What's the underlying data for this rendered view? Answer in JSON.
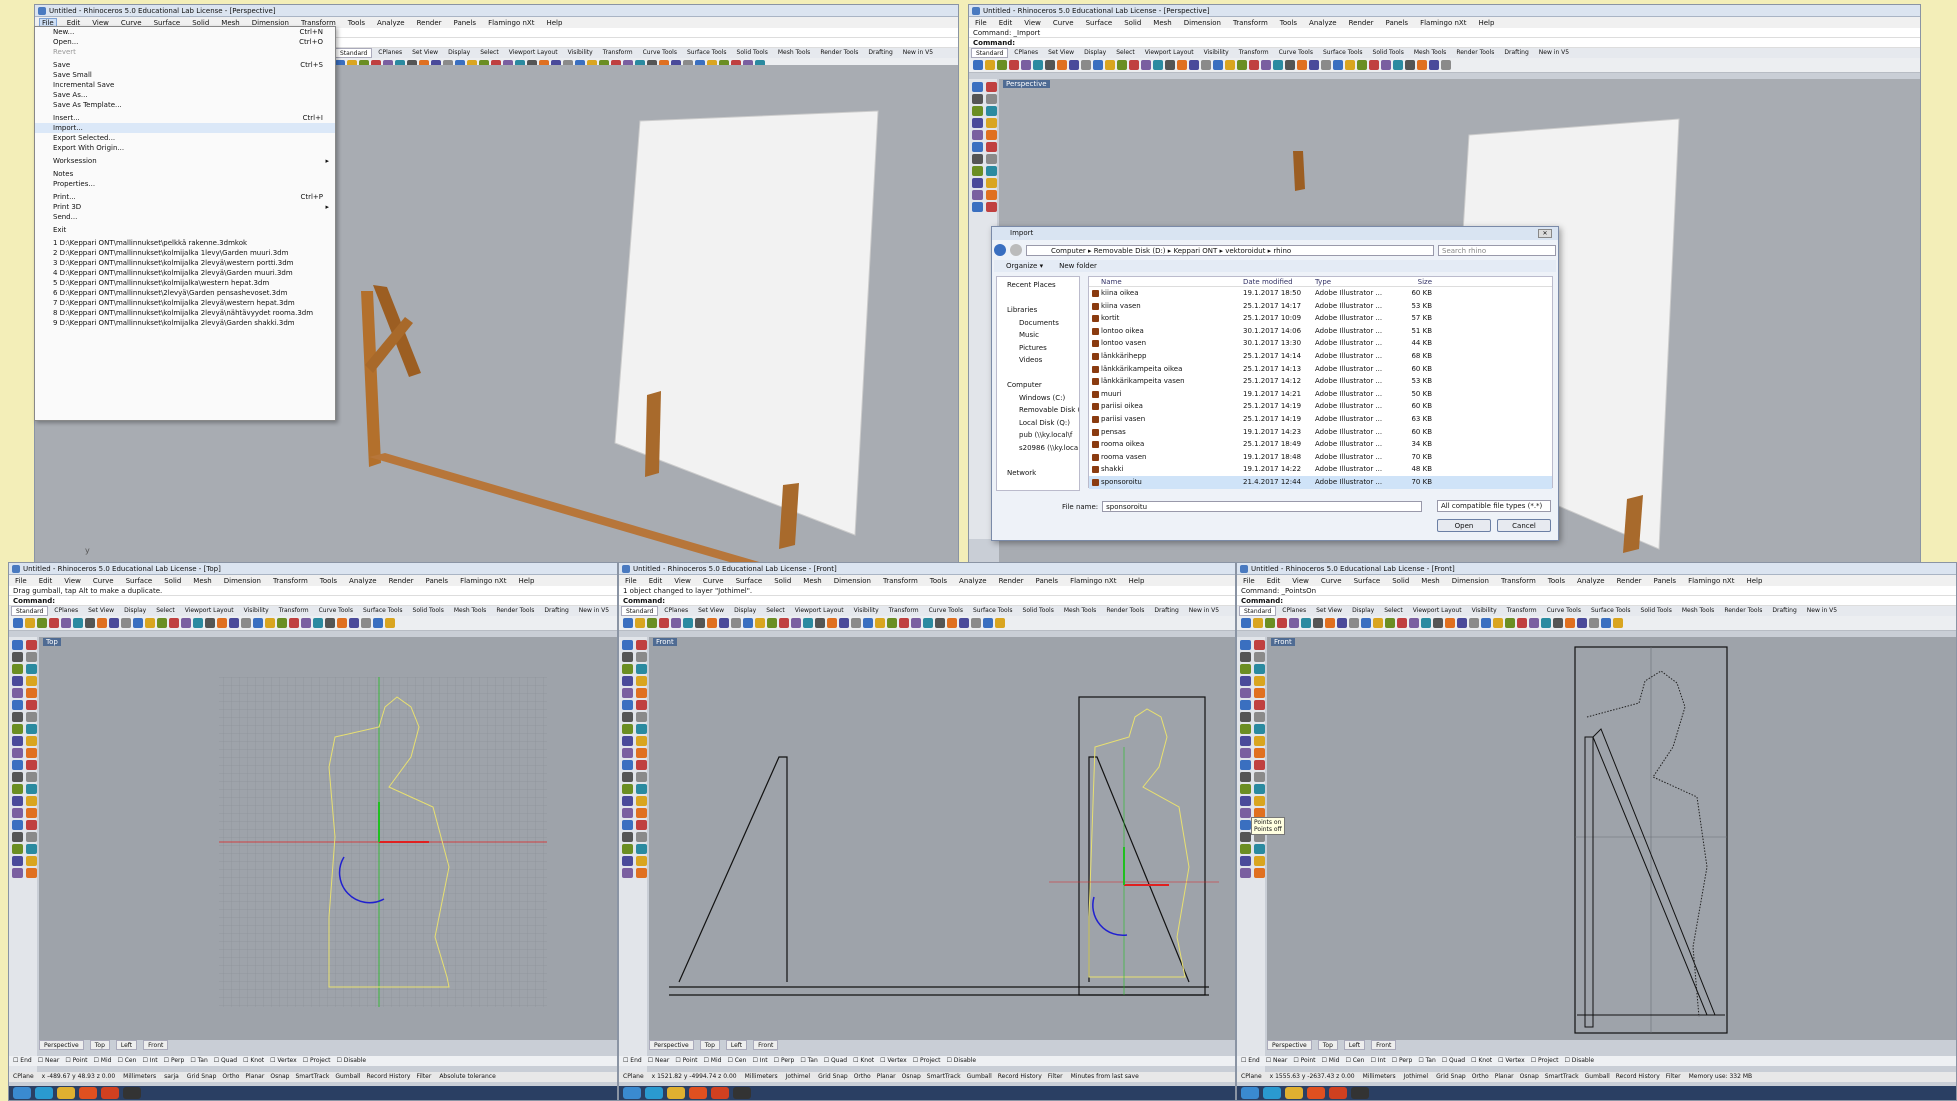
{
  "colors": {
    "accent": "#4a7ac0",
    "curve_yellow": "#e8e070",
    "axis_red": "#e02020",
    "axis_green": "#20c020"
  },
  "menus": [
    "File",
    "Edit",
    "View",
    "Curve",
    "Surface",
    "Solid",
    "Mesh",
    "Dimension",
    "Transform",
    "Tools",
    "Analyze",
    "Render",
    "Panels",
    "Flamingo nXt",
    "Help"
  ],
  "toolbar_tabs": [
    "Standard",
    "CPlanes",
    "Set View",
    "Display",
    "Select",
    "Viewport Layout",
    "Visibility",
    "Transform",
    "Curve Tools",
    "Surface Tools",
    "Solid Tools",
    "Mesh Tools",
    "Render Tools",
    "Drafting",
    "New in V5"
  ],
  "viewport_tabs": [
    "Perspective",
    "Top",
    "Left",
    "Front"
  ],
  "osnaps": [
    "End",
    "Near",
    "Point",
    "Mid",
    "Cen",
    "Int",
    "Perp",
    "Tan",
    "Quad",
    "Knot",
    "Vertex",
    "Project",
    "Disable"
  ],
  "status": {
    "cplane": "CPlane",
    "units": "Millimeters",
    "layer": "sarja",
    "items": [
      "Grid Snap",
      "Ortho",
      "Planar",
      "Osnap",
      "SmartTrack",
      "Gumball",
      "Record History",
      "Filter"
    ]
  },
  "win1": {
    "title": "Untitled - Rhinoceros 5.0 Educational Lab License - [Perspective]",
    "cmd1": "",
    "cmd2": ""
  },
  "win2": {
    "title": "Untitled - Rhinoceros 5.0 Educational Lab License - [Perspective]",
    "cmd1": "Command: _Import",
    "cmd2": "Command:",
    "viewport": "Perspective"
  },
  "win3": {
    "title": "Untitled - Rhinoceros 5.0 Educational Lab License - [Top]",
    "cmd1": "Drag gumball, tap Alt to make a duplicate.",
    "cmd2": "Command:",
    "viewport": "Top",
    "coords": "x -489.67  y 48.93  z 0.00",
    "filter": "Absolute tolerance"
  },
  "win4": {
    "title": "Untitled - Rhinoceros 5.0 Educational Lab License - [Front]",
    "cmd1": "1 object changed to layer \"Jothimel\".",
    "cmd2": "Command:",
    "viewport": "Front",
    "coords": "x 1521.82  y -4994.74  z 0.00",
    "layer": "Jothimel",
    "filter": "Minutes from last save"
  },
  "win5": {
    "title": "Untitled - Rhinoceros 5.0 Educational Lab License - [Front]",
    "cmd1": "Command: _PointsOn",
    "cmd2": "Command:",
    "viewport": "Front",
    "coords": "x 1555.63  y -2637.43  z 0.00",
    "layer": "Jothimel",
    "filter": "Memory use: 332 MB",
    "tooltip1": "Points on",
    "tooltip2": "Points off"
  },
  "filemenu": [
    {
      "label": "New...",
      "sc": "Ctrl+N"
    },
    {
      "label": "Open...",
      "sc": "Ctrl+O"
    },
    {
      "label": "Revert",
      "sc": "",
      "dis": true
    },
    {
      "sep": true
    },
    {
      "label": "Save",
      "sc": "Ctrl+S"
    },
    {
      "label": "Save Small",
      "sc": ""
    },
    {
      "label": "Incremental Save",
      "sc": ""
    },
    {
      "label": "Save As...",
      "sc": ""
    },
    {
      "label": "Save As Template...",
      "sc": ""
    },
    {
      "sep": true
    },
    {
      "label": "Insert...",
      "sc": "Ctrl+I"
    },
    {
      "label": "Import...",
      "sc": "",
      "hl": true
    },
    {
      "label": "Export Selected...",
      "sc": ""
    },
    {
      "label": "Export With Origin...",
      "sc": ""
    },
    {
      "sep": true
    },
    {
      "label": "Worksession",
      "sc": "",
      "sub": true
    },
    {
      "sep": true
    },
    {
      "label": "Notes",
      "sc": ""
    },
    {
      "label": "Properties...",
      "sc": ""
    },
    {
      "sep": true
    },
    {
      "label": "Print...",
      "sc": "Ctrl+P"
    },
    {
      "label": "Print 3D",
      "sc": "",
      "sub": true
    },
    {
      "label": "Send...",
      "sc": ""
    },
    {
      "sep": true
    },
    {
      "label": "Exit",
      "sc": ""
    },
    {
      "sep": true
    },
    {
      "label": "1 D:\\Keppari ONT\\mallinnukset\\pelkkä rakenne.3dmkok",
      "sc": ""
    },
    {
      "label": "2 D:\\Keppari ONT\\mallinnukset\\kolmijalka 1levy\\Garden muuri.3dm",
      "sc": ""
    },
    {
      "label": "3 D:\\Keppari ONT\\mallinnukset\\kolmijalka 2levyä\\western portti.3dm",
      "sc": ""
    },
    {
      "label": "4 D:\\Keppari ONT\\mallinnukset\\kolmijalka 2levyä\\Garden muuri.3dm",
      "sc": ""
    },
    {
      "label": "5 D:\\Keppari ONT\\mallinnukset\\kolmijalka\\western hepat.3dm",
      "sc": ""
    },
    {
      "label": "6 D:\\Keppari ONT\\mallinnukset\\2levyä\\Garden pensashevoset.3dm",
      "sc": ""
    },
    {
      "label": "7 D:\\Keppari ONT\\mallinnukset\\kolmijalka 2levyä\\western hepat.3dm",
      "sc": ""
    },
    {
      "label": "8 D:\\Keppari ONT\\mallinnukset\\kolmijalka 2levyä\\nähtävyydet rooma.3dm",
      "sc": ""
    },
    {
      "label": "9 D:\\Keppari ONT\\mallinnukset\\kolmijalka 2levyä\\Garden shakki.3dm",
      "sc": ""
    }
  ],
  "import": {
    "title": "Import",
    "breadcrumb": "Computer  ▸  Removable Disk (D:)  ▸  Keppari ONT  ▸  vektoroidut  ▸  rhino",
    "search": "Search rhino",
    "organize": "Organize ▾",
    "newfolder": "New folder",
    "nav": [
      "Recent Places",
      "",
      "Libraries",
      "Documents",
      "Music",
      "Pictures",
      "Videos",
      "",
      "Computer",
      "Windows (C:)",
      "Removable Disk (",
      "Local Disk (Q:)",
      "pub (\\\\ky.local\\f",
      "s20986 (\\\\ky.loca",
      "",
      "Network"
    ],
    "headers": [
      "Name",
      "Date modified",
      "Type",
      "Size"
    ],
    "files": [
      [
        "kiina oikea",
        "19.1.2017 18:50",
        "Adobe Illustrator ...",
        "60 KB"
      ],
      [
        "kiina vasen",
        "25.1.2017 14:17",
        "Adobe Illustrator ...",
        "53 KB"
      ],
      [
        "kortit",
        "25.1.2017 10:09",
        "Adobe Illustrator ...",
        "57 KB"
      ],
      [
        "lontoo oikea",
        "30.1.2017 14:06",
        "Adobe Illustrator ...",
        "51 KB"
      ],
      [
        "lontoo vasen",
        "30.1.2017 13:30",
        "Adobe Illustrator ...",
        "44 KB"
      ],
      [
        "länkkärihepp",
        "25.1.2017 14:14",
        "Adobe Illustrator ...",
        "68 KB"
      ],
      [
        "länkkärikampeita oikea",
        "25.1.2017 14:13",
        "Adobe Illustrator ...",
        "60 KB"
      ],
      [
        "länkkärikampeita vasen",
        "25.1.2017 14:12",
        "Adobe Illustrator ...",
        "53 KB"
      ],
      [
        "muuri",
        "19.1.2017 14:21",
        "Adobe Illustrator ...",
        "50 KB"
      ],
      [
        "pariisi oikea",
        "25.1.2017 14:19",
        "Adobe Illustrator ...",
        "60 KB"
      ],
      [
        "pariisi vasen",
        "25.1.2017 14:19",
        "Adobe Illustrator ...",
        "63 KB"
      ],
      [
        "pensas",
        "19.1.2017 14:23",
        "Adobe Illustrator ...",
        "60 KB"
      ],
      [
        "rooma oikea",
        "25.1.2017 18:49",
        "Adobe Illustrator ...",
        "34 KB"
      ],
      [
        "rooma vasen",
        "19.1.2017 18:48",
        "Adobe Illustrator ...",
        "70 KB"
      ],
      [
        "shakki",
        "19.1.2017 14:22",
        "Adobe Illustrator ...",
        "48 KB"
      ],
      [
        "sponsoroitu",
        "21.4.2017 12:44",
        "Adobe Illustrator ...",
        "70 KB"
      ]
    ],
    "filename_label": "File name:",
    "filename": "sponsoroitu",
    "filetype": "All compatible file types (*.*)",
    "open": "Open",
    "cancel": "Cancel"
  }
}
